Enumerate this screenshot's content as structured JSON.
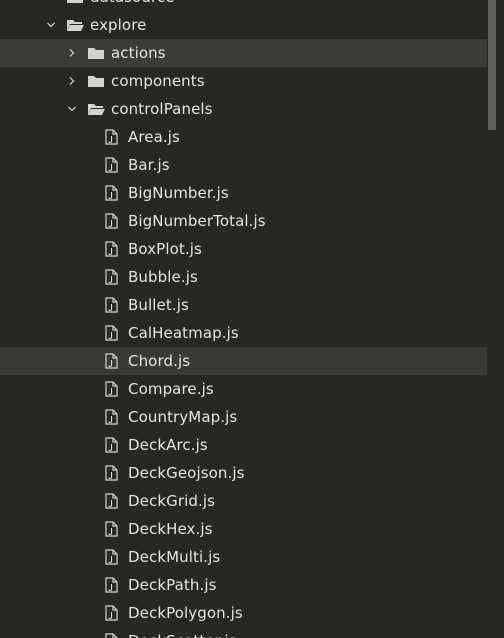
{
  "tree": {
    "top_partial": {
      "label": "datasource",
      "expanded": false
    },
    "explore": {
      "label": "explore",
      "expanded": true
    },
    "folders": [
      {
        "label": "actions",
        "expanded": false,
        "selected": true
      },
      {
        "label": "components",
        "expanded": false
      },
      {
        "label": "controlPanels",
        "expanded": true
      }
    ],
    "files": [
      {
        "label": "Area.js"
      },
      {
        "label": "Bar.js"
      },
      {
        "label": "BigNumber.js"
      },
      {
        "label": "BigNumberTotal.js"
      },
      {
        "label": "BoxPlot.js"
      },
      {
        "label": "Bubble.js"
      },
      {
        "label": "Bullet.js"
      },
      {
        "label": "CalHeatmap.js"
      },
      {
        "label": "Chord.js",
        "hovered": true
      },
      {
        "label": "Compare.js"
      },
      {
        "label": "CountryMap.js"
      },
      {
        "label": "DeckArc.js"
      },
      {
        "label": "DeckGeojson.js"
      },
      {
        "label": "DeckGrid.js"
      },
      {
        "label": "DeckHex.js"
      },
      {
        "label": "DeckMulti.js"
      },
      {
        "label": "DeckPath.js"
      },
      {
        "label": "DeckPolygon.js"
      },
      {
        "label": "DeckScatter.js"
      }
    ]
  },
  "colors": {
    "background": "#272822",
    "selected_row": "#3b3c36",
    "text": "#e6e6e0",
    "icon": "#d4d4ce",
    "scrollbar": "#5e5e5a"
  }
}
